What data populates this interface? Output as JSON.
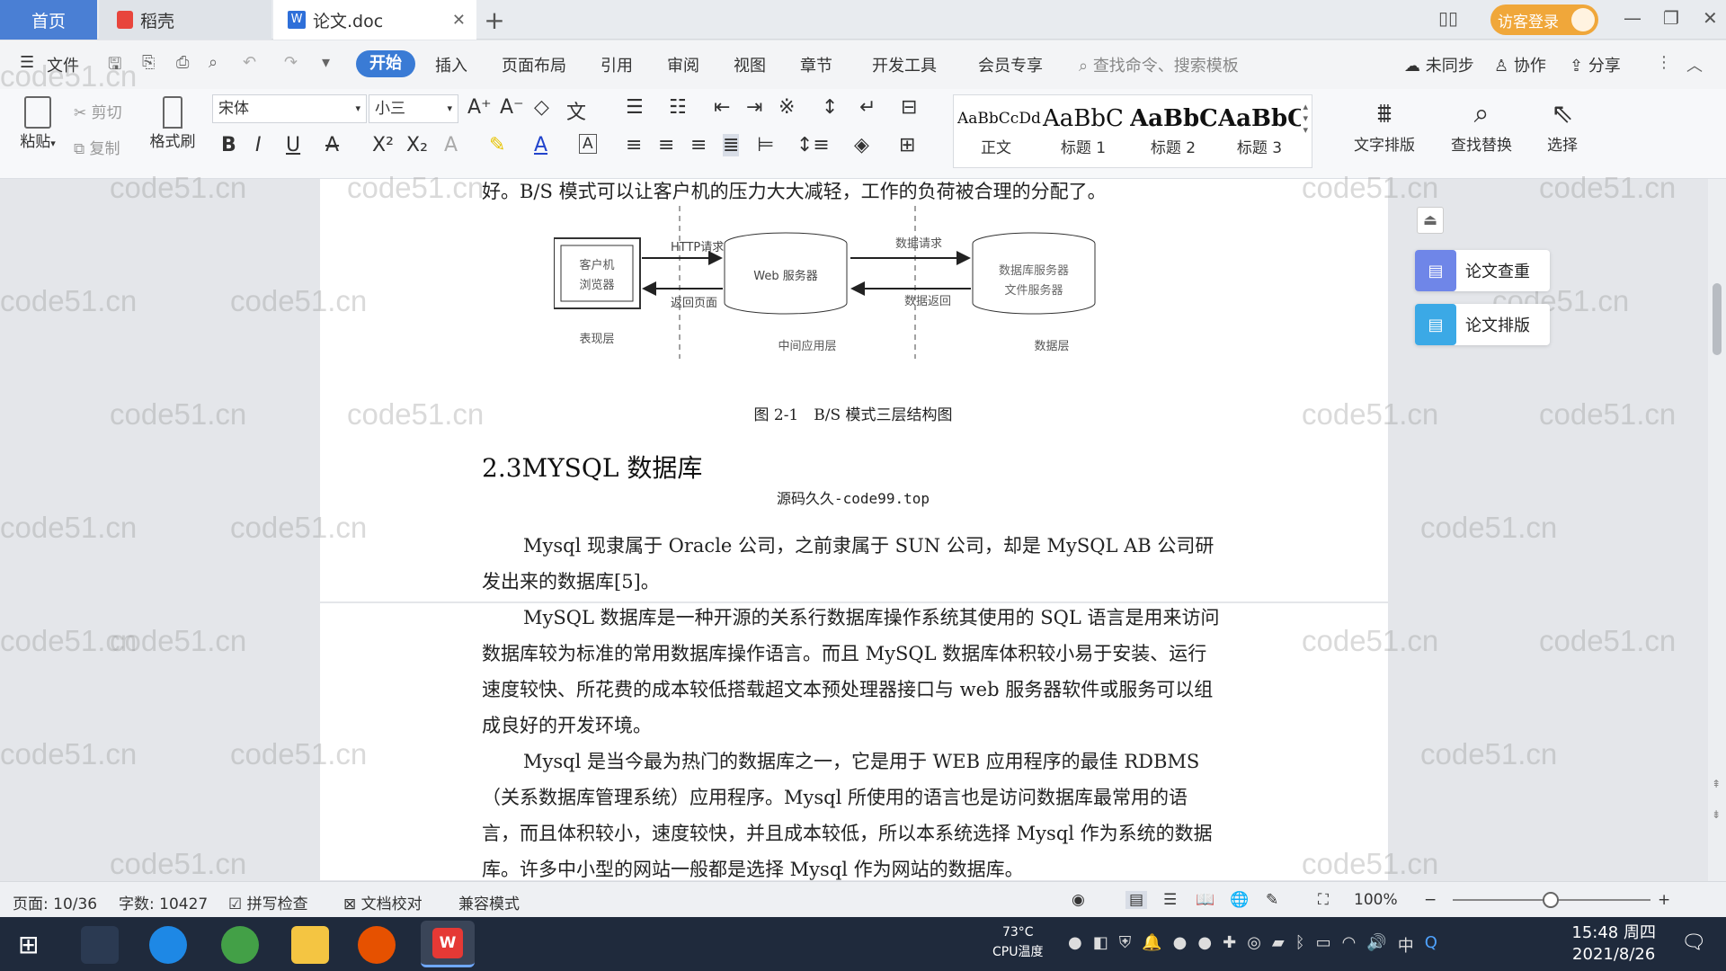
{
  "tabs": {
    "home": "首页",
    "daoke": "稻壳",
    "doc": "论文.doc"
  },
  "guest_login": "访客登录",
  "menu": {
    "file": "文件",
    "start": "开始",
    "insert": "插入",
    "layout": "页面布局",
    "reference": "引用",
    "review": "审阅",
    "view": "视图",
    "chapter": "章节",
    "devtools": "开发工具",
    "member": "会员专享",
    "search_placeholder": "查找命令、搜索模板",
    "sync": "未同步",
    "collab": "协作",
    "share": "分享"
  },
  "ribbon": {
    "paste": "粘贴",
    "cut": "剪切",
    "copy": "复制",
    "format_painter": "格式刷",
    "font": "宋体",
    "size": "小三",
    "styles": [
      {
        "sample": "AaBbCcDd",
        "label": "正文"
      },
      {
        "sample": "AaBbC",
        "label": "标题 1"
      },
      {
        "sample": "AaBbC",
        "label": "标题 2"
      },
      {
        "sample": "AaBbC",
        "label": "标题 3"
      }
    ],
    "text_layout": "文字排版",
    "find_replace": "查找替换",
    "select": "选择"
  },
  "document": {
    "top_line": "好。B/S 模式可以让客户机的压力大大减轻，工作的负荷被合理的分配了。",
    "diagram": {
      "client": [
        "客户机",
        "浏览器"
      ],
      "web": "Web 服务器",
      "db": [
        "数据库服务器",
        "文件服务器"
      ],
      "http_req": "HTTP请求",
      "return_page": "返回页面",
      "data_req": "数据请求",
      "data_return": "数据返回",
      "layer1": "表现层",
      "layer2": "中间应用层",
      "layer3": "数据层"
    },
    "figure_caption": "图 2-1　B/S 模式三层结构图",
    "heading": "2.3MYSQL 数据库",
    "source_note": "源码久久-code99.top",
    "para1": "Mysql 现隶属于 Oracle 公司，之前隶属于 SUN 公司，却是 MySQL AB 公司研发出来的数据库[5]。",
    "para2": "MySQL 数据库是一种开源的关系行数据库操作系统其使用的 SQL 语言是用来访问数据库较为标准的常用数据库操作语言。而且 MySQL 数据库体积较小易于安装、运行速度较快、所花费的成本较低搭载超文本预处理器接口与 web 服务器软件或服务可以组成良好的开发环境。",
    "para3": "Mysql 是当今最为热门的数据库之一，它是用于 WEB 应用程序的最佳 RDBMS（关系数据库管理系统）应用程序。Mysql 所使用的语言也是访问数据库最常用的语言，而且体积较小，速度较快，并且成本较低，所以本系统选择 Mysql 作为系统的数据库。许多中小型的网站一般都是选择 Mysql 作为网站的数据库。"
  },
  "side": {
    "check": "论文查重",
    "format": "论文排版"
  },
  "watermark": "code51.cn",
  "status": {
    "page": "页面: 10/36",
    "words": "字数: 10427",
    "spell": "拼写检查",
    "proof": "文档校对",
    "compat": "兼容模式",
    "zoom": "100%"
  },
  "taskbar": {
    "time": "15:48 周四",
    "date": "2021/8/26",
    "cpu_temp": "73°C",
    "cpu_label": "CPU温度",
    "ime": "中"
  }
}
